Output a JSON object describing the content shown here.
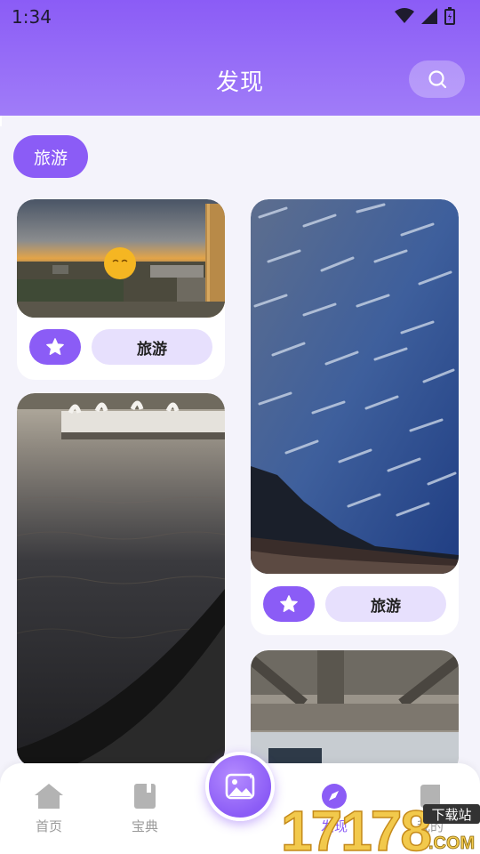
{
  "status": {
    "time": "1:34"
  },
  "header": {
    "title": "发现"
  },
  "category_chip": "旅游",
  "cards": [
    {
      "tag": "旅游",
      "scene": "city sunset with sphere"
    },
    {
      "tag": "旅游",
      "scene": "school of fish dome"
    }
  ],
  "nav": {
    "home": "首页",
    "guide": "宝典",
    "discover": "发现",
    "mine": "我的"
  },
  "watermark": {
    "number": "17178",
    "site": "下载站",
    "domain": ".COM"
  },
  "colors": {
    "accent": "#8b5cf6",
    "accent_light": "#e7e0fd"
  }
}
